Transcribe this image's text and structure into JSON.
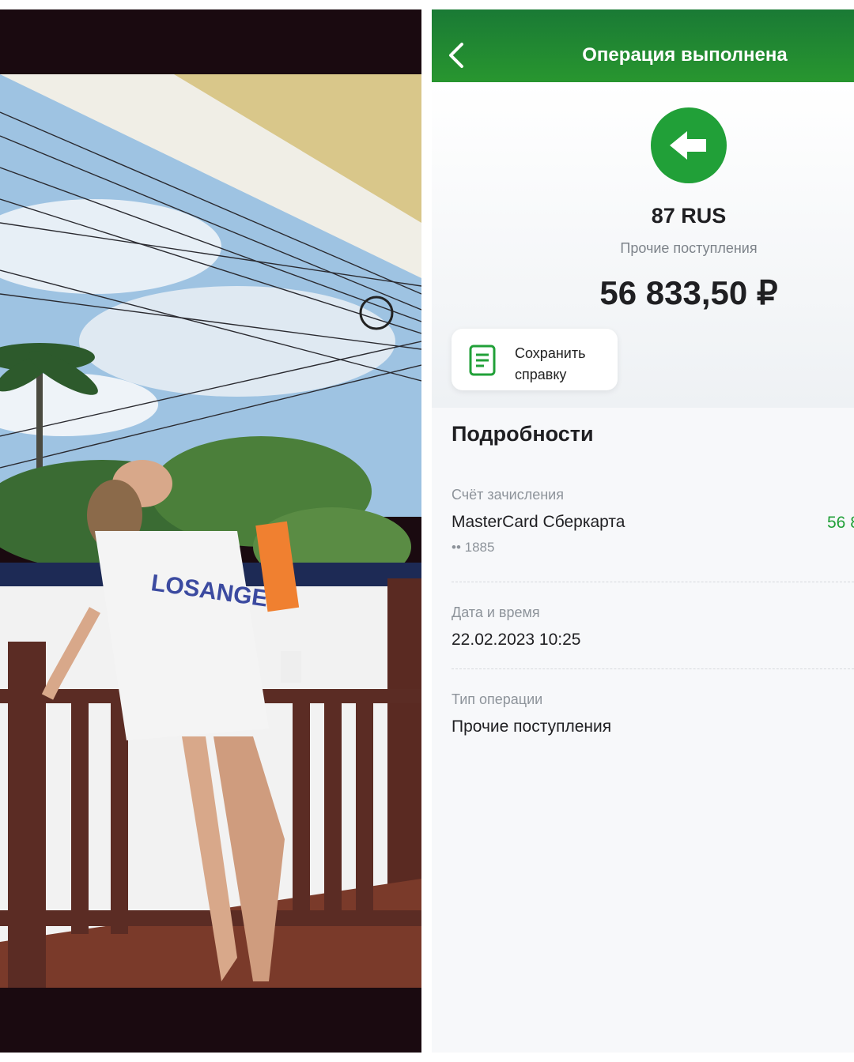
{
  "header": {
    "title": "Операция выполнена"
  },
  "operation": {
    "payer": "87 RUS",
    "category": "Прочие поступления",
    "amount": "56 833,50 ₽"
  },
  "save_button": {
    "line1": "Сохранить",
    "line2": "справку"
  },
  "details": {
    "title": "Подробности",
    "account_label": "Счёт зачисления",
    "account_value": "MasterCard Сберкарта",
    "account_amount": "56 8",
    "account_mask": "•• 1885",
    "datetime_label": "Дата и время",
    "datetime_value": "22.02.2023 10:25",
    "type_label": "Тип операции",
    "type_value": "Прочие поступления"
  },
  "colors": {
    "brand_green": "#21a038",
    "header_green": "#1a7a35"
  },
  "icons": [
    "chevron-left-icon",
    "arrow-left-icon",
    "document-icon"
  ]
}
